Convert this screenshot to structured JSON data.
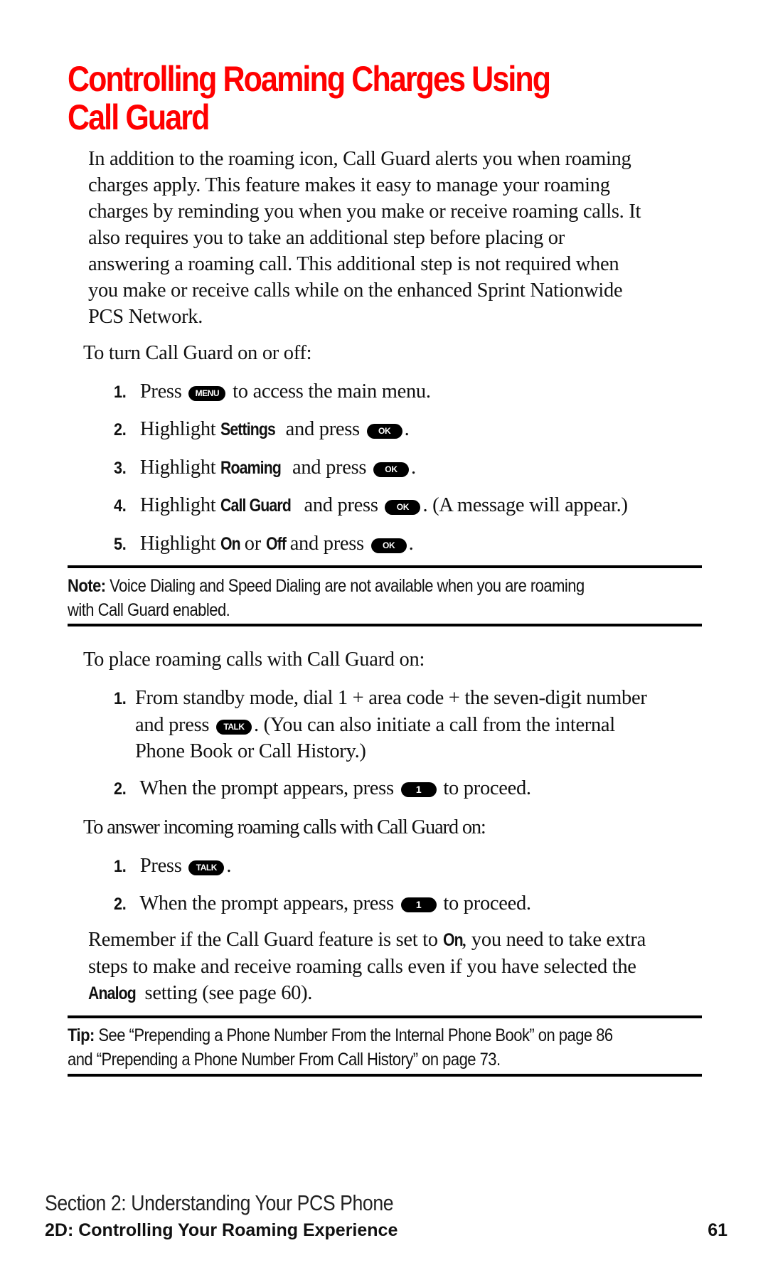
{
  "title": {
    "line1": "Controlling Roaming Charges Using",
    "line2": "Call Guard",
    "color": "#ff0000"
  },
  "intro": [
    "In addition to the roaming icon, Call Guard alerts you when roaming",
    "charges apply. This feature makes it easy to manage your roaming",
    "charges by reminding you when you make or receive roaming calls. It",
    "also requires you to take an additional step before placing or",
    "answering a roaming call. This additional step is not required when",
    "you make or receive calls while on the enhanced Sprint Nationwide",
    "PCS Network."
  ],
  "turn_on_off": {
    "heading": "To turn Call Guard on or off:",
    "steps": [
      {
        "num": "1.",
        "pre": "Press",
        "key": "MENU",
        "post": "to access the main menu."
      },
      {
        "num": "2.",
        "pre": "Highlight",
        "bold": "Settings",
        "mid": "and press",
        "key": "OK",
        "post": "."
      },
      {
        "num": "3.",
        "pre": "Highlight",
        "bold": "Roaming",
        "mid": "and press",
        "key": "OK",
        "post": "."
      },
      {
        "num": "4.",
        "pre": "Highlight",
        "bold": "Call Guard",
        "mid": "and press",
        "key": "OK",
        "post": ". (A message will appear.)"
      },
      {
        "num": "5.",
        "pre": "Highlight",
        "bold": "On",
        "or": "or",
        "bold2": "Off",
        "mid": "and press",
        "key": "OK",
        "post": "."
      }
    ]
  },
  "note": {
    "label": "Note:",
    "line1": "Voice Dialing and Speed Dialing are not available when you are roaming",
    "line2": "with Call Guard enabled."
  },
  "place_calls": {
    "heading": "To place roaming calls with Call Guard on:",
    "steps": [
      {
        "num": "1.",
        "line1": "From standby mode, dial 1 + area code + the seven-digit number",
        "line2_pre": "and press",
        "key": "TALK",
        "line2_post": ". (You can also initiate a call from the internal",
        "line3": "Phone Book or Call History.)"
      },
      {
        "num": "2.",
        "pre": "When the prompt appears, press",
        "key": "1",
        "post": "to proceed."
      }
    ]
  },
  "answer_calls": {
    "heading": "To answer incoming roaming calls with Call Guard on:",
    "steps": [
      {
        "num": "1.",
        "pre": "Press",
        "key": "TALK",
        "post": "."
      },
      {
        "num": "2.",
        "pre": "When the prompt appears, press",
        "key": "1",
        "post": "to proceed."
      }
    ]
  },
  "remember": {
    "line1_pre": "Remember if the Call Guard feature is set to",
    "line1_bold": "On",
    "line1_post": ", you need to take extra",
    "line2": "steps to make and receive roaming calls even if you have selected the",
    "line3_bold": "Analog",
    "line3_post": "setting (see page 60)."
  },
  "tip": {
    "label": "Tip:",
    "line1": "See “Prepending a Phone Number From the Internal Phone Book” on page 86",
    "line2": "and “Prepending a Phone Number From Call History” on page 73."
  },
  "footer": {
    "section": "Section 2: Understanding Your PCS Phone",
    "chapter": "2D: Controlling Your Roaming Experience",
    "page": "61"
  }
}
